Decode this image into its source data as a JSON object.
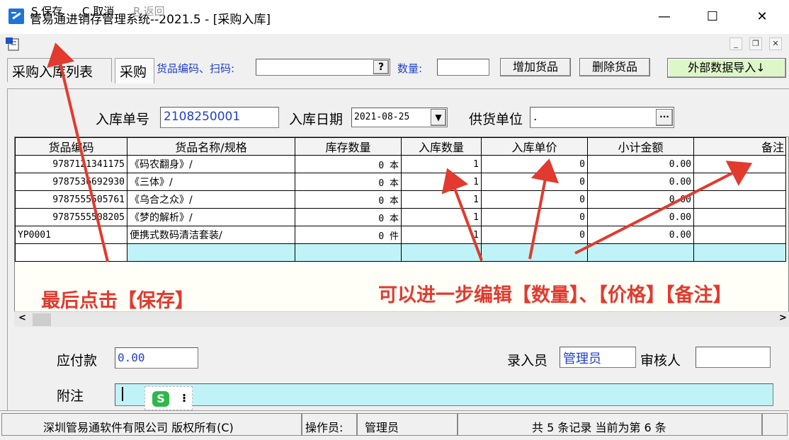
{
  "window": {
    "title": "管易通进销存管理系统--2021.5 - [采购入库]",
    "minimize_glyph": "—",
    "maximize_glyph": "☐",
    "close_glyph": "✕"
  },
  "toolbar": {
    "save_key": "S",
    "save_label": ".保存",
    "cancel_key": "C",
    "cancel_label": ".取消",
    "back_key": "R",
    "back_label": ".返回"
  },
  "tabs": {
    "list_tab": "采购入库列表",
    "entry_tab": "采购"
  },
  "entry_bar": {
    "code_label": "货品编码、扫码:",
    "code_value": "",
    "qty_label": "数量:",
    "qty_value": "",
    "add_button": "增加货品",
    "delete_button": "删除货品",
    "import_button": "外部数据导入↓",
    "lookup_button": "?"
  },
  "form": {
    "doc_no_label": "入库单号",
    "doc_no_value": "2108250001",
    "date_label": "入库日期",
    "date_value": "2021-08-25",
    "supplier_label": "供货单位",
    "supplier_value": ".",
    "supplier_lookup": "···"
  },
  "grid": {
    "columns": [
      "货品编码",
      "货品名称/规格",
      "库存数量",
      "入库数量",
      "入库单价",
      "小计金额",
      "备注"
    ],
    "rows": [
      {
        "code": "9787121341175",
        "name": "《码农翻身》/",
        "stock": "0 本",
        "qty": "1",
        "price": "0",
        "amount": "0.00",
        "note": ""
      },
      {
        "code": "9787536692930",
        "name": "《三体》/",
        "stock": "0 本",
        "qty": "1",
        "price": "0",
        "amount": "0.00",
        "note": ""
      },
      {
        "code": "9787555505761",
        "name": "《乌合之众》/",
        "stock": "0 本",
        "qty": "1",
        "price": "0",
        "amount": "0.00",
        "note": ""
      },
      {
        "code": "9787555508205",
        "name": "《梦的解析》/",
        "stock": "0 本",
        "qty": "1",
        "price": "0",
        "amount": "0.00",
        "note": ""
      },
      {
        "code": "YP0001",
        "name": "便携式数码清洁套装/",
        "stock": "0 件",
        "qty": "1",
        "price": "0",
        "amount": "0.00",
        "note": ""
      }
    ],
    "scroll_left": "<",
    "scroll_right": ">"
  },
  "annotations": {
    "save_hint": "最后点击【保存】",
    "edit_hint": "可以进一步编辑【数量】、【价格】【备注】"
  },
  "footer_form": {
    "payable_label": "应付款",
    "payable_value": "0.00",
    "operator_label": "录入员",
    "operator_value": "管理员",
    "reviewer_label": "审核人",
    "reviewer_value": "",
    "remark_label": "附注",
    "remark_value": ""
  },
  "statusbar": {
    "company": "深圳管易通软件有限公司 版权所有(C)",
    "operator_label": "操作员:",
    "operator_value": "管理员",
    "record_info": "共 5 条记录 当前为第 6 条"
  },
  "colors": {
    "annotation_red": "#e23a2e",
    "label_blue": "#1e3fd0",
    "new_row_cyan": "#bff3f7",
    "import_button_green": "#ddf7c8"
  }
}
